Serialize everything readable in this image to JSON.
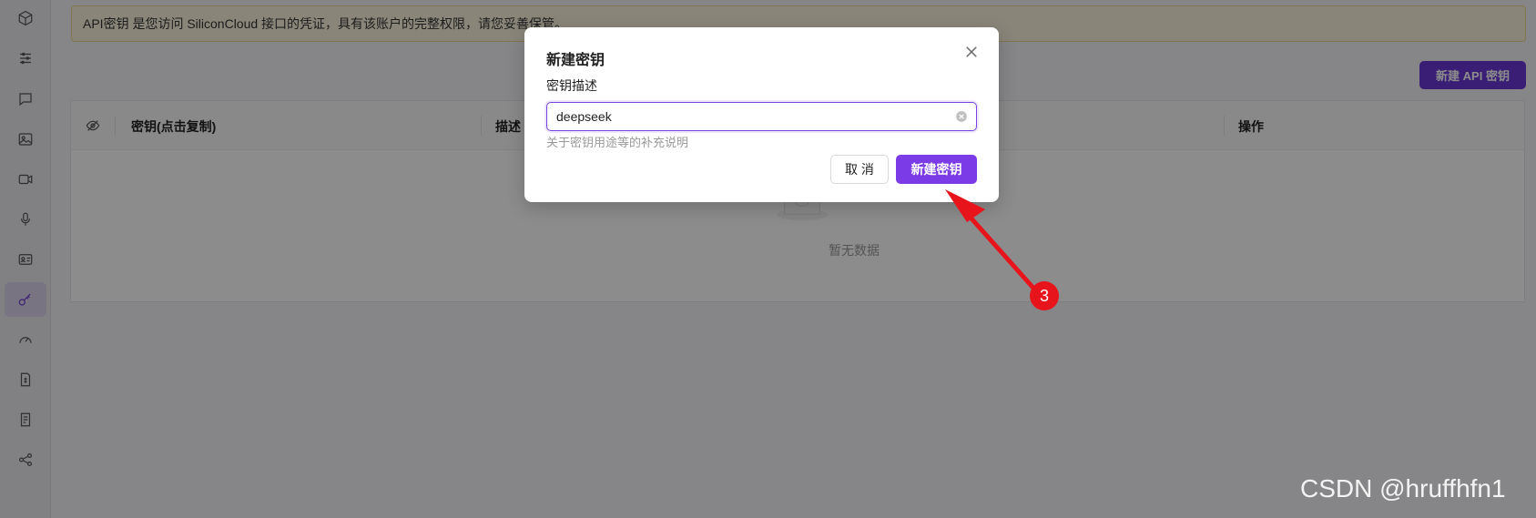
{
  "notice": {
    "text": "API密钥 是您访问 SiliconCloud 接口的凭证，具有该账户的完整权限，请您妥善保管。"
  },
  "toolbar": {
    "create_api_key_label": "新建 API 密钥"
  },
  "table": {
    "columns": [
      "密钥(点击复制)",
      "描述",
      "操作"
    ],
    "empty_text": "暂无数据"
  },
  "modal": {
    "title": "新建密钥",
    "field_label": "密钥描述",
    "input_value": "deepseek",
    "help_text": "关于密钥用途等的补充说明",
    "cancel_label": "取 消",
    "submit_label": "新建密钥"
  },
  "annotation": {
    "step_number": "3"
  },
  "watermark": "CSDN @hruffhfn1",
  "sidebar": {
    "items": [
      "cube-icon",
      "sliders-icon",
      "chat-icon",
      "image-icon",
      "video-icon",
      "microphone-icon",
      "id-card-icon",
      "key-icon",
      "speedometer-icon",
      "billing-icon",
      "invoice-icon",
      "share-icon"
    ],
    "active_item": "key-icon"
  },
  "colors": {
    "accent": "#7b3be6",
    "annotation_red": "#e8141c",
    "notice_bg": "#faf3dc"
  }
}
